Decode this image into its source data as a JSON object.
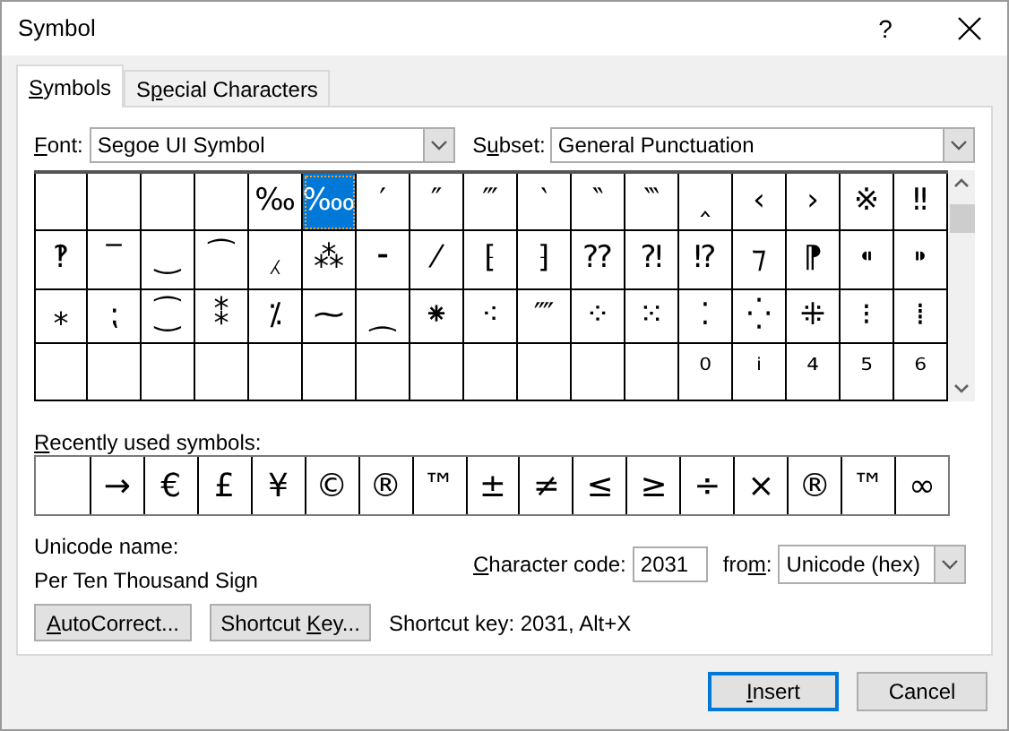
{
  "window": {
    "title": "Symbol",
    "help_button": "?"
  },
  "tabs": [
    {
      "label": {
        "key": "S",
        "post": "ymbols"
      },
      "selected": true
    },
    {
      "label": {
        "pre": "S",
        "key": "p",
        "post": "ecial Characters"
      },
      "selected": false
    }
  ],
  "font": {
    "label": {
      "key": "F",
      "post": "ont:"
    },
    "value": "Segoe UI Symbol"
  },
  "subset": {
    "label": {
      "pre": "S",
      "key": "u",
      "post": "bset:"
    },
    "value": "General Punctuation"
  },
  "symbol_grid": {
    "rows": [
      [
        {
          "selected": false
        },
        {
          "selected": false
        },
        {
          "selected": false
        },
        {
          "selected": false
        },
        {
          "char": "‰",
          "selected": false
        },
        {
          "char": "‱",
          "selected": true
        },
        {
          "char": "′",
          "selected": false
        },
        {
          "char": "″",
          "selected": false
        },
        {
          "char": "‴",
          "selected": false
        },
        {
          "char": "‵",
          "selected": false
        },
        {
          "char": "‶",
          "selected": false
        },
        {
          "char": "‷",
          "selected": false
        },
        {
          "char": "‸",
          "selected": false
        },
        {
          "char": "‹",
          "selected": false
        },
        {
          "char": "›",
          "selected": false
        },
        {
          "char": "※",
          "selected": false
        },
        {
          "char": "‼",
          "selected": false
        }
      ],
      [
        {
          "char": "‽",
          "selected": false
        },
        {
          "char": "‾",
          "selected": false
        },
        {
          "char": "‿",
          "selected": false
        },
        {
          "char": "⁀",
          "selected": false
        },
        {
          "char": "⁁",
          "selected": false
        },
        {
          "char": "⁂",
          "selected": false
        },
        {
          "char": "⁃",
          "selected": false
        },
        {
          "char": "⁄",
          "selected": false
        },
        {
          "char": "⁅",
          "selected": false
        },
        {
          "char": "⁆",
          "selected": false
        },
        {
          "char": "⁇",
          "selected": false
        },
        {
          "char": "⁈",
          "selected": false
        },
        {
          "char": "⁉",
          "selected": false
        },
        {
          "char": "⁊",
          "selected": false
        },
        {
          "char": "⁋",
          "selected": false
        },
        {
          "char": "⁌",
          "selected": false
        },
        {
          "char": "⁍",
          "selected": false
        }
      ],
      [
        {
          "char": "⁎",
          "selected": false
        },
        {
          "char": "⁏",
          "selected": false
        },
        {
          "char": "⁐",
          "selected": false
        },
        {
          "char": "⁑",
          "selected": false
        },
        {
          "char": "⁒",
          "selected": false
        },
        {
          "char": "⁓",
          "selected": false
        },
        {
          "char": "⁔",
          "selected": false
        },
        {
          "char": "⁕",
          "selected": false
        },
        {
          "char": "⁖",
          "selected": false
        },
        {
          "char": "⁗",
          "selected": false
        },
        {
          "char": "⁘",
          "selected": false
        },
        {
          "char": "⁙",
          "selected": false
        },
        {
          "char": "⁚",
          "selected": false
        },
        {
          "char": "⁛",
          "selected": false
        },
        {
          "char": "⁜",
          "selected": false
        },
        {
          "char": "⁝",
          "selected": false
        },
        {
          "char": "⁞",
          "selected": false
        }
      ],
      [
        {
          "selected": false
        },
        {
          "selected": false
        },
        {
          "selected": false
        },
        {
          "selected": false
        },
        {
          "selected": false
        },
        {
          "selected": false
        },
        {
          "selected": false
        },
        {
          "selected": false
        },
        {
          "selected": false
        },
        {
          "selected": false
        },
        {
          "selected": false
        },
        {
          "selected": false
        },
        {
          "char": "⁰",
          "selected": false
        },
        {
          "char": "ⁱ",
          "selected": false
        },
        {
          "char": "⁴",
          "selected": false
        },
        {
          "char": "⁵",
          "selected": false
        },
        {
          "char": "⁶",
          "selected": false
        }
      ]
    ]
  },
  "recently_used": {
    "label": {
      "key": "R",
      "post": "ecently used symbols:"
    },
    "symbols": [
      {
        "kind": "blank"
      },
      {
        "kind": "symbol",
        "char": "→"
      },
      {
        "kind": "symbol",
        "char": "€"
      },
      {
        "kind": "symbol",
        "char": "£"
      },
      {
        "kind": "symbol",
        "char": "¥"
      },
      {
        "kind": "symbol",
        "char": "©"
      },
      {
        "kind": "symbol",
        "char": "®"
      },
      {
        "kind": "symbol",
        "char": "™"
      },
      {
        "kind": "symbol",
        "char": "±"
      },
      {
        "kind": "symbol",
        "char": "≠"
      },
      {
        "kind": "symbol",
        "char": "≤"
      },
      {
        "kind": "symbol",
        "char": "≥"
      },
      {
        "kind": "symbol",
        "char": "÷"
      },
      {
        "kind": "symbol",
        "char": "×"
      },
      {
        "kind": "symbol",
        "char": "®"
      },
      {
        "kind": "symbol",
        "char": "™"
      },
      {
        "kind": "symbol",
        "char": "∞"
      }
    ]
  },
  "unicode_name": {
    "label": "Unicode name:",
    "value": "Per Ten Thousand Sign"
  },
  "character_code": {
    "label": {
      "key": "C",
      "post": "haracter code:"
    },
    "value": "2031"
  },
  "from": {
    "label": {
      "pre": "fro",
      "key": "m",
      "post": ":"
    },
    "value": "Unicode (hex)"
  },
  "autocorrect_button": {
    "label": {
      "key": "A",
      "post": "utoCorrect..."
    }
  },
  "shortcut_key_button": {
    "label": {
      "pre": "Shortcut ",
      "key": "K",
      "post": "ey..."
    }
  },
  "shortcut_key_text": "Shortcut key: 2031, Alt+X",
  "buttons": [
    {
      "label": {
        "key": "I",
        "post": "nsert"
      },
      "default": true
    },
    {
      "label": {
        "pre": "Cancel"
      },
      "default": false
    }
  ]
}
